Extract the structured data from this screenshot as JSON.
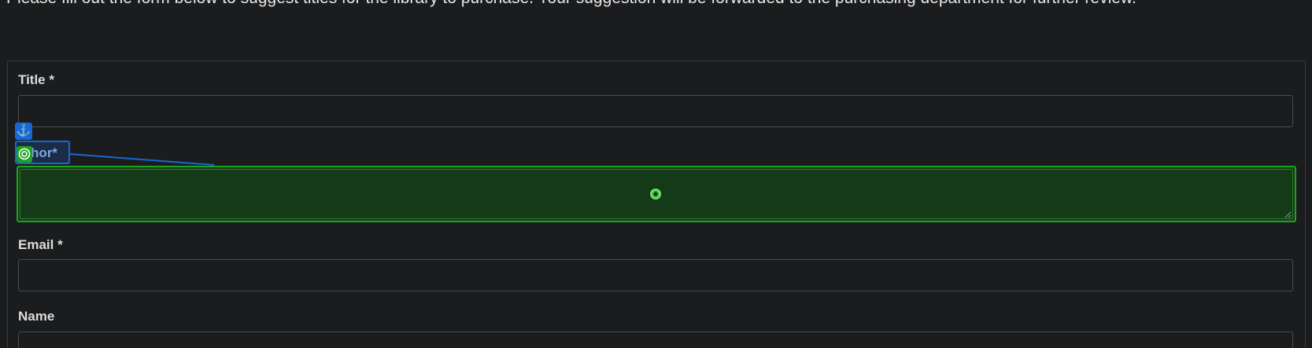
{
  "intro_text": "Please fill out the form below to suggest titles for the library to purchase. Your suggestion will be forwarded to the purchasing department for further review.",
  "form": {
    "title_label": "Title *",
    "author_label": "uthor*",
    "email_label": "Email *",
    "name_label": "Name"
  },
  "overlay": {
    "anchor_icon": "anchor-icon",
    "target_icon": "target-icon",
    "highlight_color": "#1768d6",
    "focus_color": "#1fa31f"
  }
}
